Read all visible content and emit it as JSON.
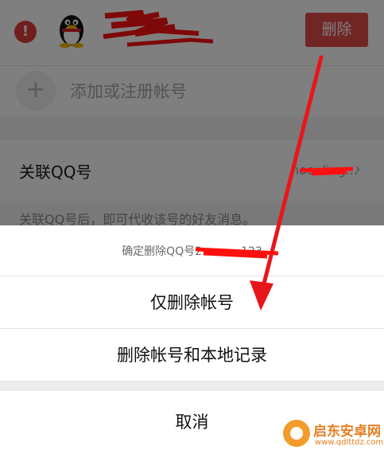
{
  "background": {
    "delete_button": "删除",
    "add_account": "添加或注册帐号",
    "linked_qq_label": "关联QQ号",
    "linked_qq_value": "hoo..ling...",
    "hint": "关联QQ号后，即可代收该号的好友消息。"
  },
  "sheet": {
    "title": "确定删除QQ号2...........123",
    "options": [
      "仅删除帐号",
      "删除帐号和本地记录"
    ],
    "cancel": "取消"
  },
  "watermark": {
    "title": "启东安卓网",
    "url": "www.qdlttdz.com"
  },
  "colors": {
    "accent_red": "#e24a4a",
    "annotation_red": "#e8161b",
    "watermark_orange": "#e67e22"
  },
  "icons": [
    "remove-icon",
    "qq-penguin-icon",
    "plus-icon",
    "chevron-right-icon",
    "watermark-logo-icon"
  ]
}
